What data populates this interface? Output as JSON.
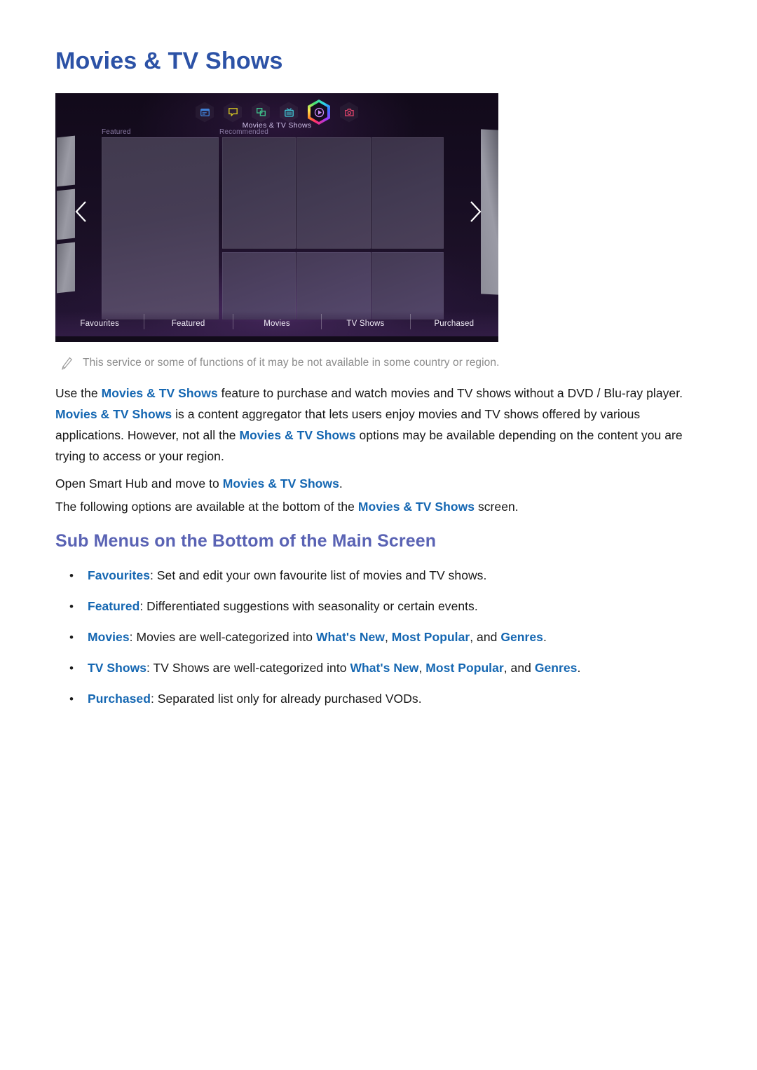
{
  "page": {
    "title": "Movies & TV Shows"
  },
  "tv_screen": {
    "selected_label": "Movies & TV Shows",
    "section_labels": {
      "featured": "Featured",
      "recommended": "Recommended"
    },
    "icons": [
      {
        "name": "apps-panel-icon",
        "color": "#3f7fd4"
      },
      {
        "name": "speech-bubble-icon",
        "color": "#d4c423"
      },
      {
        "name": "multi-window-icon",
        "color": "#3fbf8a"
      },
      {
        "name": "tv-icon",
        "color": "#3fc4d4"
      },
      {
        "name": "movies-play-icon",
        "color": "#b05cf0"
      },
      {
        "name": "camera-icon",
        "color": "#e0436b"
      }
    ],
    "nav": {
      "prev": "previous-page-arrow",
      "next": "next-page-arrow"
    },
    "menu_items": [
      "Favourites",
      "Featured",
      "Movies",
      "TV Shows",
      "Purchased"
    ]
  },
  "note": {
    "icon": "pencil-note-icon",
    "text": "This service or some of functions of it may be not available in some country or region."
  },
  "body": {
    "paragraph_main": {
      "segments": [
        {
          "text": "Use the ",
          "style": "normal"
        },
        {
          "text": "Movies & TV Shows",
          "style": "highlight"
        },
        {
          "text": " feature to purchase and watch movies and TV shows without a DVD / Blu-ray player. ",
          "style": "normal"
        },
        {
          "text": "Movies & TV Shows",
          "style": "highlight"
        },
        {
          "text": " is a content aggregator that lets users enjoy movies and TV shows offered by various applications. However, not all the ",
          "style": "normal"
        },
        {
          "text": "Movies & TV Shows",
          "style": "highlight"
        },
        {
          "text": " options may be available depending on the content you are trying to access or your region.",
          "style": "normal"
        }
      ]
    },
    "paragraph_open": {
      "segments": [
        {
          "text": "Open Smart Hub and move to ",
          "style": "normal"
        },
        {
          "text": "Movies & TV Shows",
          "style": "highlight"
        },
        {
          "text": ".",
          "style": "normal"
        }
      ]
    },
    "paragraph_options": {
      "segments": [
        {
          "text": "The following options are available at the bottom of the ",
          "style": "normal"
        },
        {
          "text": "Movies & TV Shows",
          "style": "highlight"
        },
        {
          "text": " screen.",
          "style": "normal"
        }
      ]
    }
  },
  "sub_section": {
    "heading": "Sub Menus on the Bottom of the Main Screen",
    "bullet_marker": "•",
    "bullets": [
      {
        "name": "bullet-favourites",
        "segments": [
          {
            "text": "Favourites",
            "style": "highlight"
          },
          {
            "text": ": Set and edit your own favourite list of movies and TV shows.",
            "style": "normal"
          }
        ]
      },
      {
        "name": "bullet-featured",
        "segments": [
          {
            "text": "Featured",
            "style": "highlight"
          },
          {
            "text": ": Differentiated suggestions with seasonality or certain events.",
            "style": "normal"
          }
        ]
      },
      {
        "name": "bullet-movies",
        "segments": [
          {
            "text": "Movies",
            "style": "highlight"
          },
          {
            "text": ": Movies are well-categorized into ",
            "style": "normal"
          },
          {
            "text": "What's New",
            "style": "highlight"
          },
          {
            "text": ", ",
            "style": "normal"
          },
          {
            "text": "Most Popular",
            "style": "highlight"
          },
          {
            "text": ", and ",
            "style": "normal"
          },
          {
            "text": "Genres",
            "style": "highlight"
          },
          {
            "text": ".",
            "style": "normal"
          }
        ]
      },
      {
        "name": "bullet-tv-shows",
        "segments": [
          {
            "text": "TV Shows",
            "style": "highlight"
          },
          {
            "text": ": TV Shows are well-categorized into ",
            "style": "normal"
          },
          {
            "text": "What's New",
            "style": "highlight"
          },
          {
            "text": ", ",
            "style": "normal"
          },
          {
            "text": "Most Popular",
            "style": "highlight"
          },
          {
            "text": ", and ",
            "style": "normal"
          },
          {
            "text": "Genres",
            "style": "highlight"
          },
          {
            "text": ".",
            "style": "normal"
          }
        ]
      },
      {
        "name": "bullet-purchased",
        "segments": [
          {
            "text": "Purchased",
            "style": "highlight"
          },
          {
            "text": ": Separated list only for already purchased VODs.",
            "style": "normal"
          }
        ]
      }
    ]
  },
  "colors": {
    "title_blue": "#2c52a6",
    "subheading_blue": "#5a63b4",
    "inline_link_blue": "#1567b2",
    "note_gray": "#8b8b8b",
    "body_text": "#171717"
  }
}
